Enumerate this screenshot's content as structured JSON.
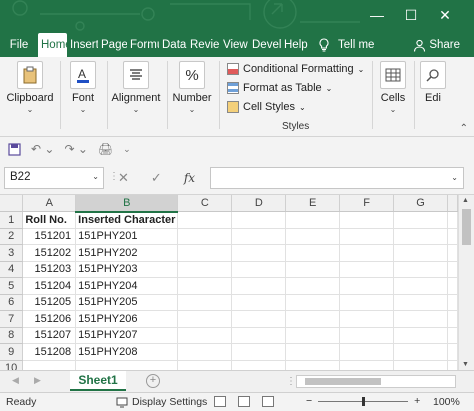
{
  "tabs": [
    "File",
    "Home",
    "Insert",
    "Page",
    "Formu",
    "Data",
    "Revie",
    "View",
    "Devel",
    "Help"
  ],
  "active_tab": "Home",
  "tell_me": "Tell me",
  "share": "Share",
  "ribbon": {
    "clipboard": "Clipboard",
    "font": "Font",
    "alignment": "Alignment",
    "number": "Number",
    "conditional_formatting": "Conditional Formatting",
    "format_as_table": "Format as Table",
    "cell_styles": "Cell Styles",
    "styles_group": "Styles",
    "cells": "Cells",
    "editing": "Edi"
  },
  "name_box": "B22",
  "fx": "fx",
  "columns": [
    "A",
    "B",
    "C",
    "D",
    "E",
    "F",
    "G"
  ],
  "rows": [
    {
      "n": "1",
      "a": "Roll No.",
      "b": "Inserted Character"
    },
    {
      "n": "2",
      "a": "151201",
      "b": "151PHY201"
    },
    {
      "n": "3",
      "a": "151202",
      "b": "151PHY202"
    },
    {
      "n": "4",
      "a": "151203",
      "b": "151PHY203"
    },
    {
      "n": "5",
      "a": "151204",
      "b": "151PHY204"
    },
    {
      "n": "6",
      "a": "151205",
      "b": "151PHY205"
    },
    {
      "n": "7",
      "a": "151206",
      "b": "151PHY206"
    },
    {
      "n": "8",
      "a": "151207",
      "b": "151PHY207"
    },
    {
      "n": "9",
      "a": "151208",
      "b": "151PHY208"
    },
    {
      "n": "10",
      "a": "",
      "b": ""
    }
  ],
  "sheet_tab": "Sheet1",
  "status": {
    "ready": "Ready",
    "display_settings": "Display Settings",
    "zoom": "100%"
  },
  "colors": {
    "brand": "#217346",
    "ribbon_bg": "#f3f3f3"
  }
}
